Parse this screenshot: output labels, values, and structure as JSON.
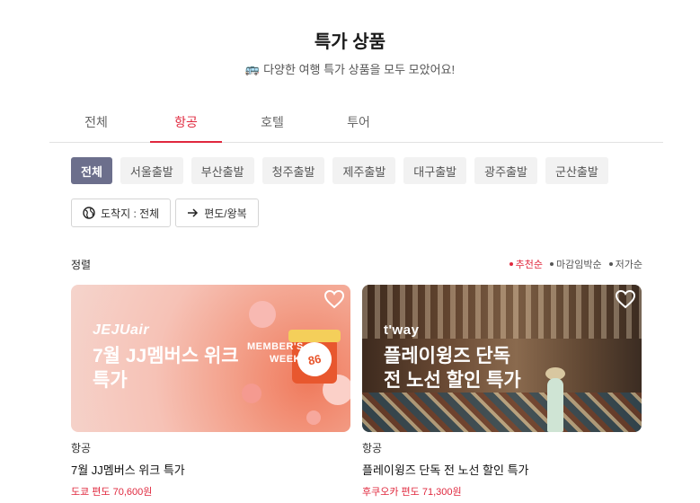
{
  "header": {
    "title": "특가 상품",
    "subtitle": "다양한 여행 특가 상품을 모두 모았어요!",
    "subtitle_icon": "bus-icon"
  },
  "tabs": [
    {
      "label": "전체",
      "active": false
    },
    {
      "label": "항공",
      "active": true
    },
    {
      "label": "호텔",
      "active": false
    },
    {
      "label": "투어",
      "active": false
    }
  ],
  "departure_chips": [
    {
      "label": "전체",
      "active": true
    },
    {
      "label": "서울출발",
      "active": false
    },
    {
      "label": "부산출발",
      "active": false
    },
    {
      "label": "청주출발",
      "active": false
    },
    {
      "label": "제주출발",
      "active": false
    },
    {
      "label": "대구출발",
      "active": false
    },
    {
      "label": "광주출발",
      "active": false
    },
    {
      "label": "군산출발",
      "active": false
    }
  ],
  "filters": {
    "destination": {
      "label": "도착지 : 전체",
      "icon": "globe-icon"
    },
    "trip_type": {
      "label": "편도/왕복",
      "icon": "arrow-right-icon"
    }
  },
  "sort": {
    "label": "정렬",
    "options": [
      {
        "label": "추천순",
        "active": true
      },
      {
        "label": "마감임박순",
        "active": false
      },
      {
        "label": "저가순",
        "active": false
      }
    ]
  },
  "products": [
    {
      "brand": "JEJUair",
      "image_title": "7월 JJ멤버스 위크\n특가",
      "badge": "86",
      "promo_mark": "MEMBER'S WEEK",
      "category": "항공",
      "name": "7월 JJ멤버스 위크 특가",
      "price": "도쿄 편도 70,600원"
    },
    {
      "brand": "t'way",
      "image_title": "플레이윙즈 단독\n전 노선 할인 특가",
      "category": "항공",
      "name": "플레이윙즈 단독 전 노선 할인 특가",
      "price": "후쿠오카 편도 71,300원"
    }
  ],
  "colors": {
    "accent": "#e0283e",
    "chip_active": "#6c6f8c",
    "chip_bg": "#f2f2f2"
  }
}
